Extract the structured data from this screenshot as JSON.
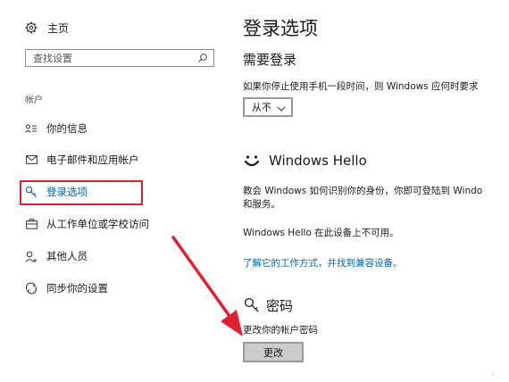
{
  "sidebar": {
    "home_label": "主页",
    "search_placeholder": "查找设置",
    "section_label": "帐户",
    "items": [
      {
        "label": "你的信息",
        "icon": "person-card-icon"
      },
      {
        "label": "电子邮件和应用帐户",
        "icon": "mail-icon"
      },
      {
        "label": "登录选项",
        "icon": "key-icon",
        "active": true
      },
      {
        "label": "从工作单位或学校访问",
        "icon": "briefcase-icon"
      },
      {
        "label": "其他人员",
        "icon": "person-add-icon"
      },
      {
        "label": "同步你的设置",
        "icon": "sync-icon"
      }
    ]
  },
  "main": {
    "title": "登录选项",
    "require_signin": {
      "title": "需要登录",
      "description": "如果你停止使用手机一段时间，则 Windows 应何时要求",
      "dropdown_value": "从不"
    },
    "windows_hello": {
      "title": "Windows Hello",
      "description_line1": "教会 Windows 如何识别你的身份，你即可登陆到 Windo",
      "description_line2": "和服务。",
      "unavailable": "Windows Hello 在此设备上不可用。",
      "link": "了解它的工作方式，并找到兼容设备。"
    },
    "password": {
      "title": "密码",
      "description": "更改你的帐户密码",
      "button_label": "更改"
    }
  },
  "colors": {
    "accent": "#0063b1",
    "annotation": "#e0202e",
    "button_bg": "#cccccc"
  },
  "stray_mark": "·'"
}
